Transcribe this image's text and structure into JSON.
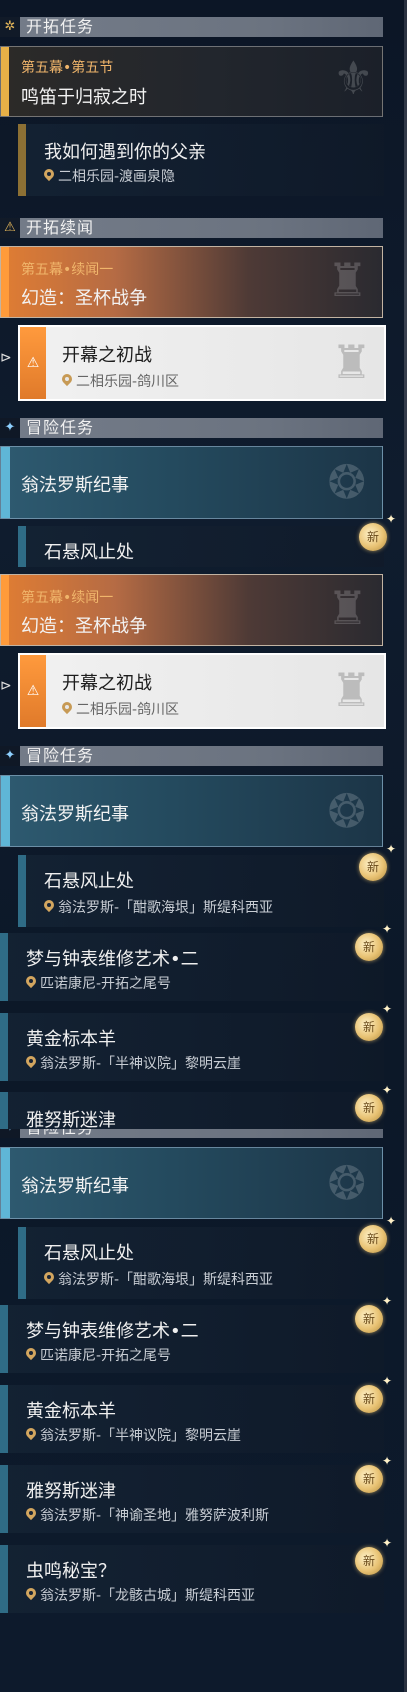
{
  "seg1": {
    "trailblaze_header": "开拓任务",
    "trailblaze_quest": {
      "subtitle": "第五幕•第五节",
      "title": "鸣笛于归寂之时"
    },
    "trailblaze_item": {
      "title": "我如何遇到你的父亲",
      "location": "二相乐园-渡画泉隐"
    },
    "companion_header": "开拓续闻",
    "companion_quest": {
      "subtitle": "第五幕•续闻一",
      "title": "幻造：圣杯战争"
    },
    "selected_item": {
      "title": "开幕之初战",
      "location": "二相乐园-鸽川区"
    },
    "adventure_header": "冒险任务",
    "adventure_group": "翁法罗斯纪事",
    "partial_item": "石悬风止处"
  },
  "seg2": {
    "companion_quest": {
      "subtitle": "第五幕•续闻一",
      "title": "幻造：圣杯战争"
    },
    "selected_item": {
      "title": "开幕之初战",
      "location": "二相乐园-鸽川区"
    },
    "adventure_header": "冒险任务",
    "adventure_group": "翁法罗斯纪事",
    "items": [
      {
        "title": "石悬风止处",
        "location": "翁法罗斯-「酣歌海垠」斯缇科西亚"
      },
      {
        "title": "梦与钟表维修艺术•二",
        "location": "匹诺康尼-开拓之尾号"
      },
      {
        "title": "黄金标本羊",
        "location": "翁法罗斯-「半神议院」黎明云崖"
      }
    ],
    "partial_item": "雅努斯迷津"
  },
  "seg3": {
    "adventure_header": "冒险任务",
    "adventure_group": "翁法罗斯纪事",
    "items": [
      {
        "title": "石悬风止处",
        "location": "翁法罗斯-「酣歌海垠」斯缇科西亚"
      },
      {
        "title": "梦与钟表维修艺术•二",
        "location": "匹诺康尼-开拓之尾号"
      },
      {
        "title": "黄金标本羊",
        "location": "翁法罗斯-「半神议院」黎明云崖"
      },
      {
        "title": "雅努斯迷津",
        "location": "翁法罗斯-「神谕圣地」雅努萨波利斯"
      },
      {
        "title": "虫鸣秘宝？",
        "location": "翁法罗斯-「龙骸古城」斯缇科西亚"
      }
    ]
  },
  "badge_label": "新",
  "colors": {
    "accent_gold": "#e7b047",
    "accent_orange": "#e07d33",
    "accent_blue": "#5fb6d7"
  }
}
